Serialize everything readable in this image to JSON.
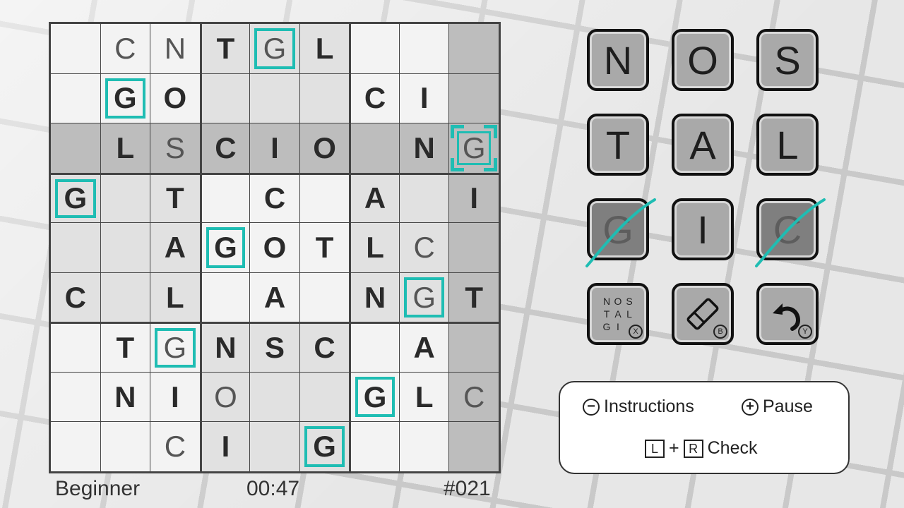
{
  "grid": [
    [
      {
        "l": "",
        "t": "empty",
        "b": 1
      },
      {
        "l": "C",
        "t": "user",
        "b": 1
      },
      {
        "l": "N",
        "t": "user",
        "b": 1
      },
      {
        "l": "T",
        "t": "given",
        "b": 2
      },
      {
        "l": "G",
        "t": "user",
        "b": 2,
        "h": true
      },
      {
        "l": "L",
        "t": "given",
        "b": 2
      },
      {
        "l": "",
        "t": "empty",
        "b": 1
      },
      {
        "l": "",
        "t": "empty",
        "b": 1
      },
      {
        "l": "",
        "t": "empty",
        "b": 3
      }
    ],
    [
      {
        "l": "",
        "t": "empty",
        "b": 1
      },
      {
        "l": "G",
        "t": "given",
        "b": 1,
        "h": true
      },
      {
        "l": "O",
        "t": "given",
        "b": 1
      },
      {
        "l": "",
        "t": "empty",
        "b": 2
      },
      {
        "l": "",
        "t": "empty",
        "b": 2
      },
      {
        "l": "",
        "t": "empty",
        "b": 2
      },
      {
        "l": "C",
        "t": "given",
        "b": 1
      },
      {
        "l": "I",
        "t": "given",
        "b": 1
      },
      {
        "l": "",
        "t": "empty",
        "b": 3
      }
    ],
    [
      {
        "l": "",
        "t": "empty",
        "b": 3
      },
      {
        "l": "L",
        "t": "given",
        "b": 3
      },
      {
        "l": "S",
        "t": "user",
        "b": 3
      },
      {
        "l": "C",
        "t": "given",
        "b": 3
      },
      {
        "l": "I",
        "t": "given",
        "b": 3
      },
      {
        "l": "O",
        "t": "given",
        "b": 3
      },
      {
        "l": "",
        "t": "empty",
        "b": 3
      },
      {
        "l": "N",
        "t": "given",
        "b": 3
      },
      {
        "l": "G",
        "t": "user",
        "b": 3,
        "cursor": true
      }
    ],
    [
      {
        "l": "G",
        "t": "given",
        "b": 2,
        "h": true
      },
      {
        "l": "",
        "t": "empty",
        "b": 2
      },
      {
        "l": "T",
        "t": "given",
        "b": 2
      },
      {
        "l": "",
        "t": "empty",
        "b": 1
      },
      {
        "l": "C",
        "t": "given",
        "b": 1
      },
      {
        "l": "",
        "t": "empty",
        "b": 1
      },
      {
        "l": "A",
        "t": "given",
        "b": 2
      },
      {
        "l": "",
        "t": "empty",
        "b": 2
      },
      {
        "l": "I",
        "t": "given",
        "b": 3
      }
    ],
    [
      {
        "l": "",
        "t": "empty",
        "b": 2
      },
      {
        "l": "",
        "t": "empty",
        "b": 2
      },
      {
        "l": "A",
        "t": "given",
        "b": 2
      },
      {
        "l": "G",
        "t": "given",
        "b": 1,
        "h": true
      },
      {
        "l": "O",
        "t": "given",
        "b": 1
      },
      {
        "l": "T",
        "t": "given",
        "b": 1
      },
      {
        "l": "L",
        "t": "given",
        "b": 2
      },
      {
        "l": "C",
        "t": "user",
        "b": 2
      },
      {
        "l": "",
        "t": "empty",
        "b": 3
      }
    ],
    [
      {
        "l": "C",
        "t": "given",
        "b": 2
      },
      {
        "l": "",
        "t": "empty",
        "b": 2
      },
      {
        "l": "L",
        "t": "given",
        "b": 2
      },
      {
        "l": "",
        "t": "empty",
        "b": 1
      },
      {
        "l": "A",
        "t": "given",
        "b": 1
      },
      {
        "l": "",
        "t": "empty",
        "b": 1
      },
      {
        "l": "N",
        "t": "given",
        "b": 2
      },
      {
        "l": "G",
        "t": "user",
        "b": 2,
        "h": true
      },
      {
        "l": "T",
        "t": "given",
        "b": 3
      }
    ],
    [
      {
        "l": "",
        "t": "empty",
        "b": 1
      },
      {
        "l": "T",
        "t": "given",
        "b": 1
      },
      {
        "l": "G",
        "t": "user",
        "b": 1,
        "h": true
      },
      {
        "l": "N",
        "t": "given",
        "b": 2
      },
      {
        "l": "S",
        "t": "given",
        "b": 2
      },
      {
        "l": "C",
        "t": "given",
        "b": 2
      },
      {
        "l": "",
        "t": "empty",
        "b": 1
      },
      {
        "l": "A",
        "t": "given",
        "b": 1
      },
      {
        "l": "",
        "t": "empty",
        "b": 3
      }
    ],
    [
      {
        "l": "",
        "t": "empty",
        "b": 1
      },
      {
        "l": "N",
        "t": "given",
        "b": 1
      },
      {
        "l": "I",
        "t": "given",
        "b": 1
      },
      {
        "l": "O",
        "t": "user",
        "b": 2
      },
      {
        "l": "",
        "t": "empty",
        "b": 2
      },
      {
        "l": "",
        "t": "empty",
        "b": 2
      },
      {
        "l": "G",
        "t": "given",
        "b": 1,
        "h": true
      },
      {
        "l": "L",
        "t": "given",
        "b": 1
      },
      {
        "l": "C",
        "t": "user",
        "b": 3
      }
    ],
    [
      {
        "l": "",
        "t": "empty",
        "b": 1
      },
      {
        "l": "",
        "t": "empty",
        "b": 1
      },
      {
        "l": "C",
        "t": "user",
        "b": 1
      },
      {
        "l": "I",
        "t": "given",
        "b": 2
      },
      {
        "l": "",
        "t": "empty",
        "b": 2
      },
      {
        "l": "G",
        "t": "given",
        "b": 2,
        "h": true
      },
      {
        "l": "",
        "t": "empty",
        "b": 1
      },
      {
        "l": "",
        "t": "empty",
        "b": 1
      },
      {
        "l": "",
        "t": "empty",
        "b": 3
      }
    ]
  ],
  "footer": {
    "level": "Beginner",
    "time": "00:47",
    "puzzle_number": "#021"
  },
  "tiles": [
    {
      "letter": "N",
      "used": false
    },
    {
      "letter": "O",
      "used": false
    },
    {
      "letter": "S",
      "used": false
    },
    {
      "letter": "T",
      "used": false
    },
    {
      "letter": "A",
      "used": false
    },
    {
      "letter": "L",
      "used": false
    },
    {
      "letter": "G",
      "used": true
    },
    {
      "letter": "I",
      "used": false
    },
    {
      "letter": "C",
      "used": true
    }
  ],
  "tools": {
    "mini_letters": [
      "N",
      "O",
      "S",
      "T",
      "A",
      "L",
      "G",
      "I"
    ],
    "notes_badge": "X",
    "eraser_badge": "B",
    "undo_badge": "Y"
  },
  "help": {
    "instructions_label": "Instructions",
    "pause_label": "Pause",
    "check_label": "Check",
    "minus_symbol": "−",
    "plus_symbol": "+",
    "l_key": "L",
    "r_key": "R",
    "plus_join": "+"
  },
  "colors": {
    "accent": "#1fbdb3",
    "tile": "#a9a9a9",
    "tile_used": "#7f7f7f"
  }
}
